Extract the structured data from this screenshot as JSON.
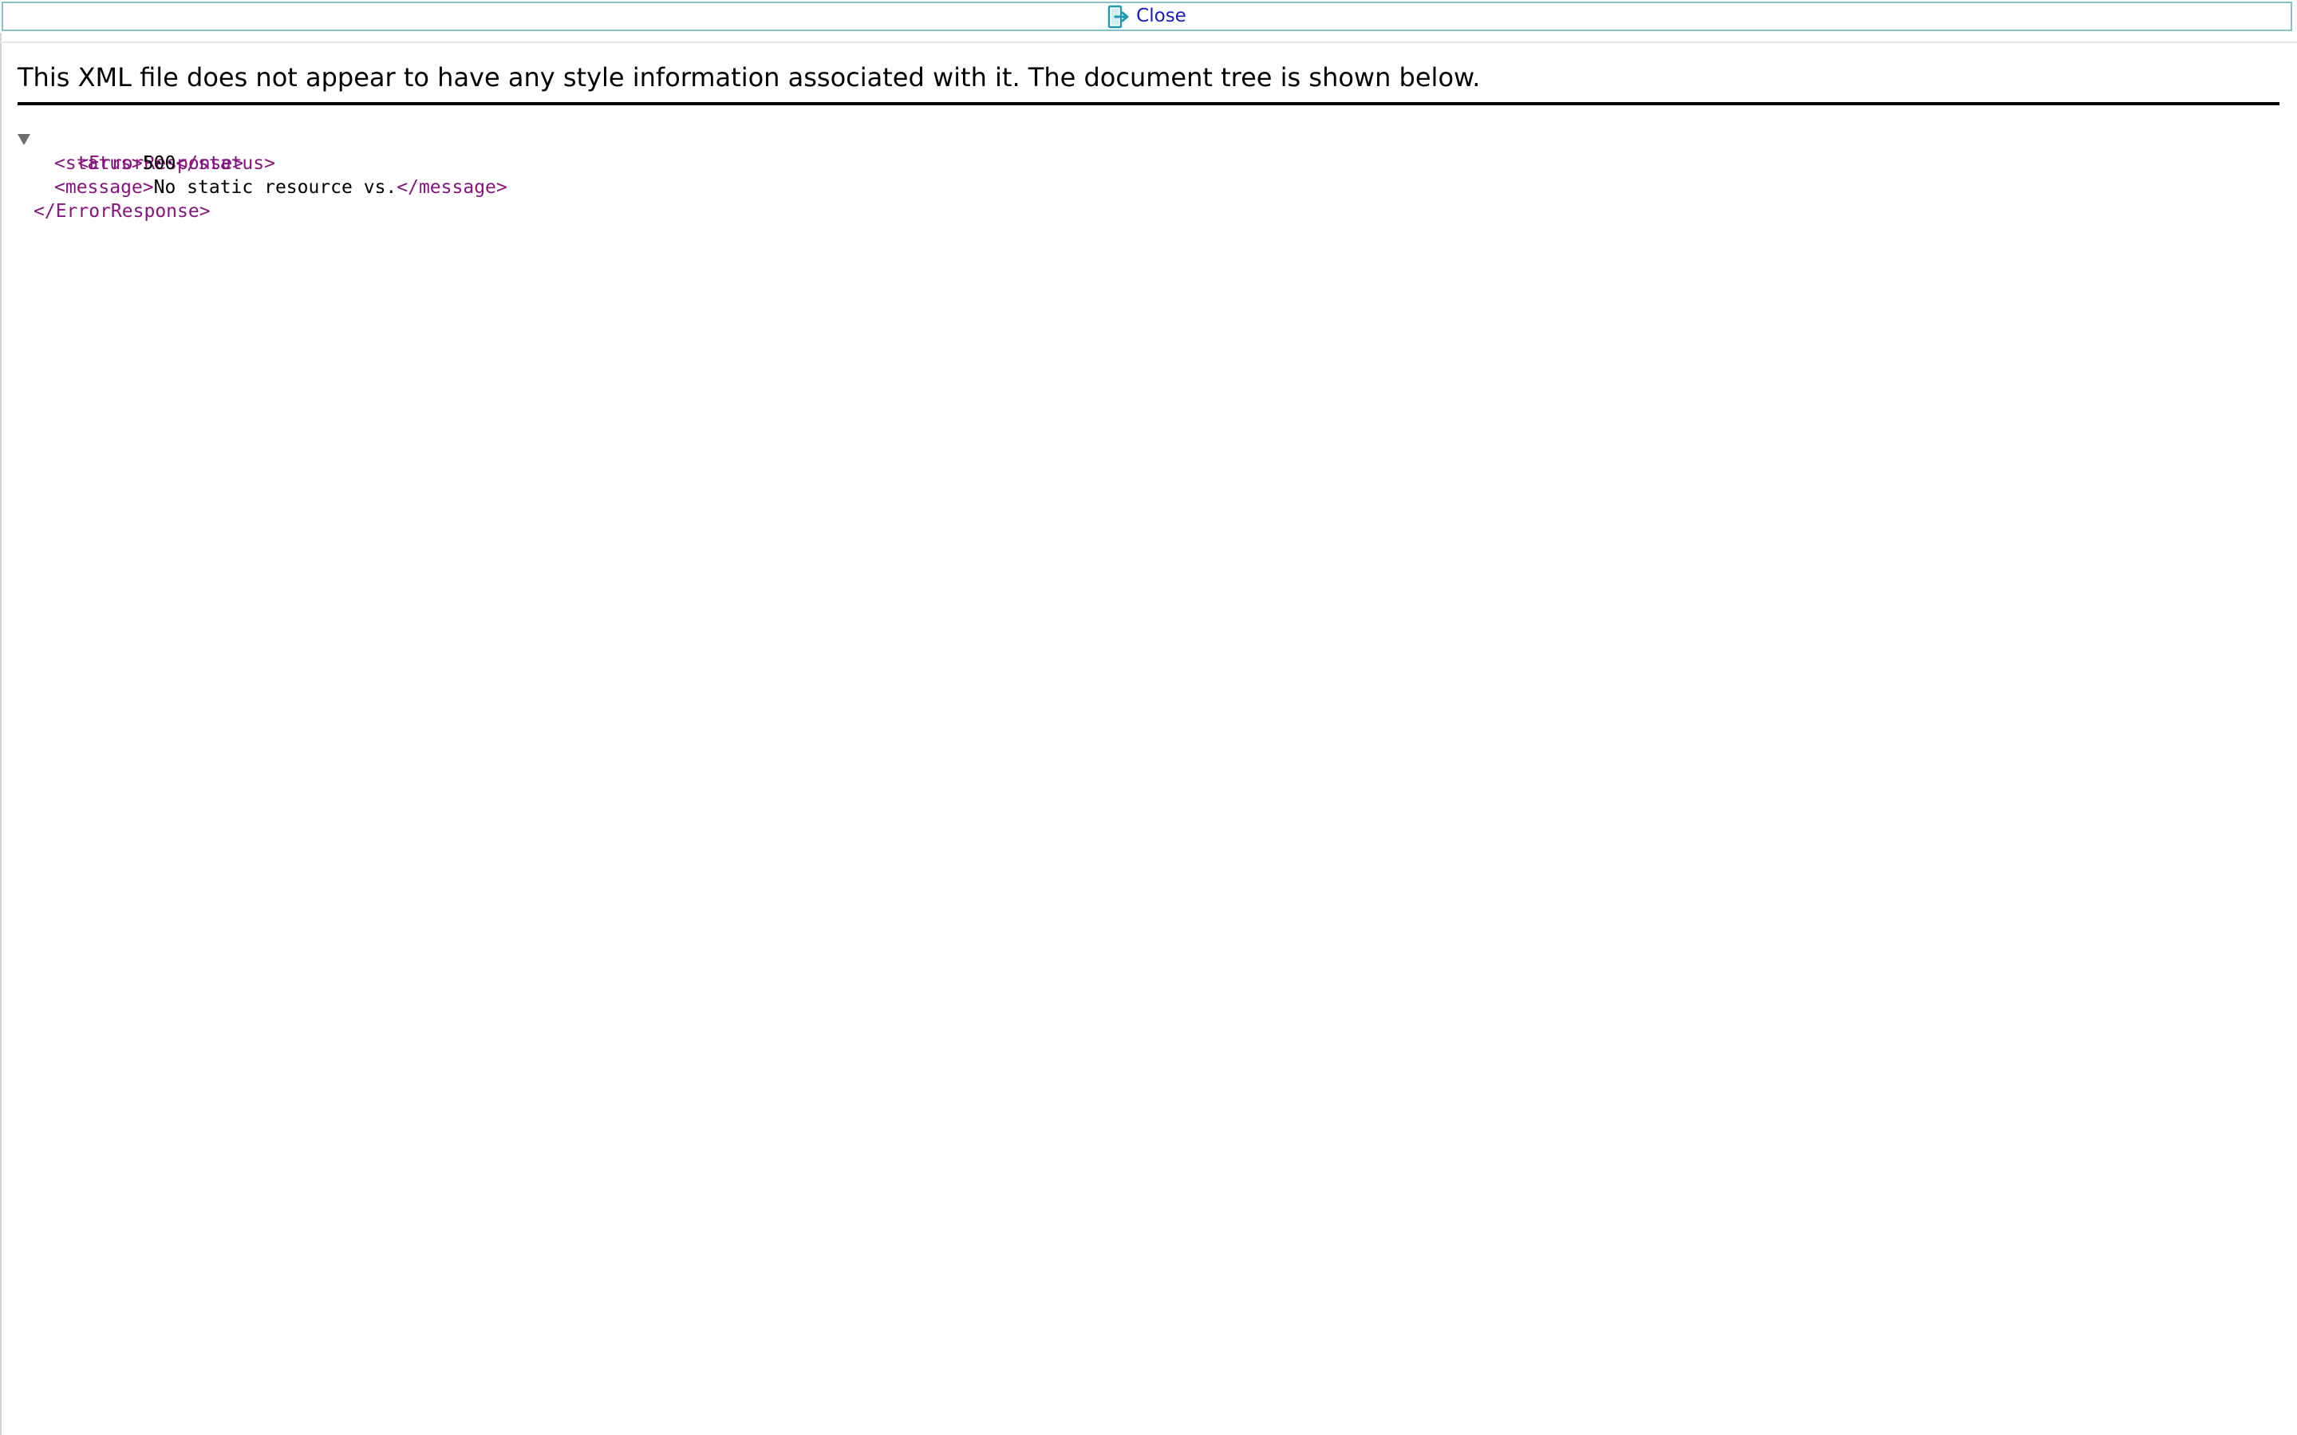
{
  "toolbar": {
    "close_label": "Close",
    "close_icon": "exit-icon",
    "border_color": "#86c2c7",
    "label_color": "#1a1ac8"
  },
  "notice": {
    "text": "This XML file does not appear to have any style information associated with it. The document tree is shown below."
  },
  "xml_tree": {
    "root_open": "<ErrorResponse>",
    "root_close": "</ErrorResponse>",
    "children": [
      {
        "open": "<status>",
        "value": "500",
        "close": "</status>"
      },
      {
        "open": "<message>",
        "value": "No static resource vs.",
        "close": "</message>"
      }
    ],
    "tag_color": "#881280"
  }
}
